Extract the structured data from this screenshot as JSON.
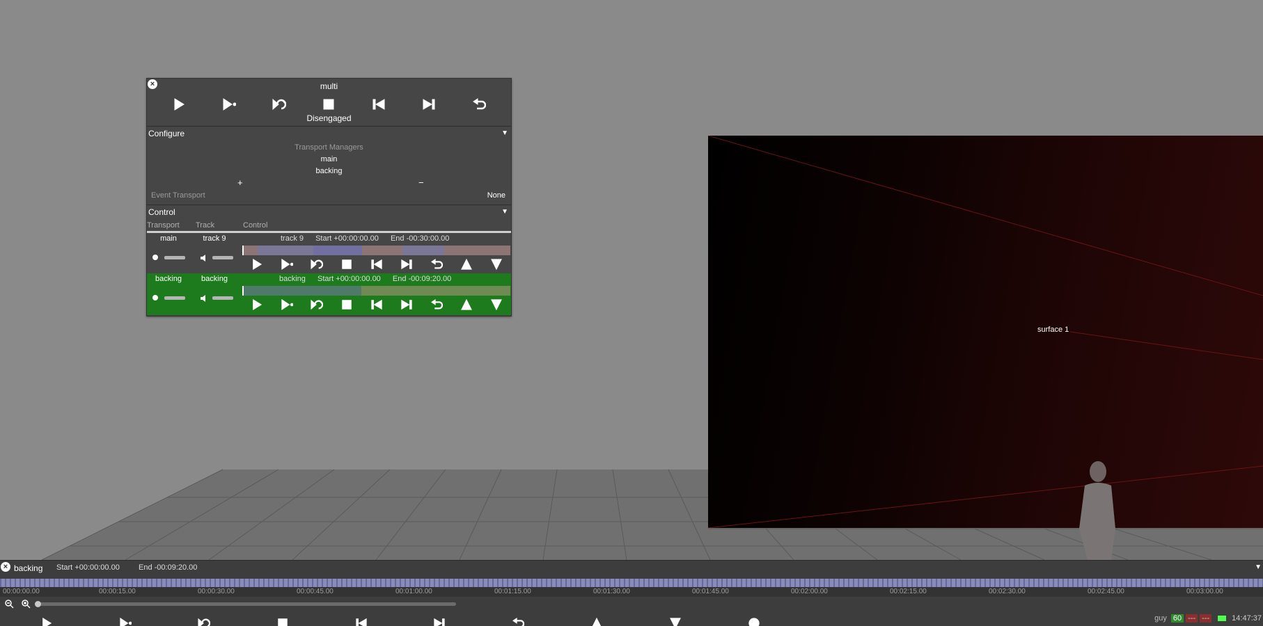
{
  "scene": {
    "surface_label": "surface 1"
  },
  "multi": {
    "title": "multi",
    "status": "Disengaged",
    "configure": {
      "header": "Configure",
      "transport_managers_label": "Transport Managers",
      "managers": [
        "main",
        "backing"
      ],
      "add": "+",
      "remove": "−",
      "event_transport_label": "Event Transport",
      "event_transport_value": "None"
    },
    "control": {
      "header": "Control",
      "columns": {
        "transport": "Transport",
        "track": "Track",
        "control": "Control"
      },
      "rows": [
        {
          "transport": "main",
          "track": "track 9",
          "info_name": "track 9",
          "start": "Start +00:00:00.00",
          "end": "End -00:30:00.00",
          "progress": 0.0
        },
        {
          "transport": "backing",
          "track": "backing",
          "info_name": "backing",
          "start": "Start +00:00:00.00",
          "end": "End -00:09:20.00",
          "progress": 0.44
        }
      ]
    },
    "icons": [
      "play-icon",
      "play-from-icon",
      "loop-icon",
      "stop-icon",
      "skip-back-icon",
      "skip-forward-icon",
      "return-icon"
    ],
    "row_icons": [
      "play-icon",
      "play-from-icon",
      "loop-icon",
      "stop-icon",
      "skip-back-icon",
      "skip-forward-icon",
      "return-icon",
      "triangle-up-icon",
      "triangle-down-icon"
    ]
  },
  "timeline": {
    "name": "backing",
    "start": "Start +00:00:00.00",
    "end": "End -00:09:20.00",
    "ticks": [
      "00:00:00.00",
      "00:00:15.00",
      "00:00:30.00",
      "00:00:45.00",
      "00:01:00.00",
      "00:01:15.00",
      "00:01:30.00",
      "00:01:45.00",
      "00:02:00.00",
      "00:02:15.00",
      "00:02:30.00",
      "00:02:45.00",
      "00:03:00.00"
    ],
    "icons": [
      "play-icon",
      "play-from-icon",
      "loop-icon",
      "stop-icon",
      "skip-back-icon",
      "skip-forward-icon",
      "return-icon",
      "triangle-up-icon",
      "triangle-down-icon",
      "record-icon"
    ]
  },
  "status": {
    "user": "guy",
    "fps": "60",
    "indicator1": "---",
    "indicator2": "---",
    "time": "14:47:37"
  },
  "colors": {
    "panel_bg": "#464646",
    "active_row": "#1d7a1d",
    "timeline_track": "#7c7ea6"
  }
}
